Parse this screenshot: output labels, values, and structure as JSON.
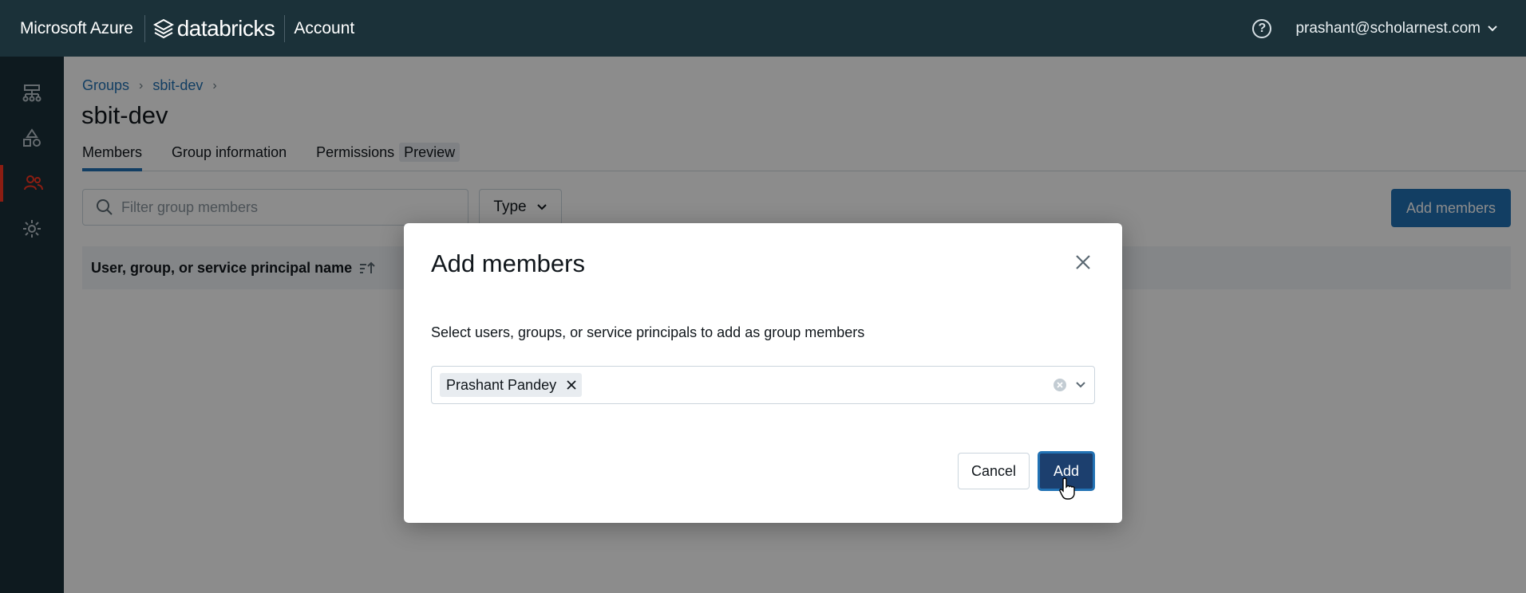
{
  "topbar": {
    "brand_azure": "Microsoft Azure",
    "brand_databricks": "databricks",
    "brand_account": "Account",
    "help_icon": "help-circle-icon",
    "user_email": "prashant@scholarnest.com"
  },
  "sidebar": {
    "items": [
      {
        "icon": "workspaces-icon"
      },
      {
        "icon": "catalog-icon"
      },
      {
        "icon": "user-management-icon",
        "active": true
      },
      {
        "icon": "settings-icon"
      }
    ],
    "active_color": "#ff3621"
  },
  "breadcrumb": {
    "items": [
      "Groups",
      "sbit-dev"
    ],
    "separator": "›"
  },
  "page": {
    "title": "sbit-dev"
  },
  "tabs": [
    {
      "label": "Members",
      "active": true
    },
    {
      "label": "Group information"
    },
    {
      "label": "Permissions",
      "badge": "Preview"
    }
  ],
  "toolbar": {
    "filter_placeholder": "Filter group members",
    "type_label": "Type",
    "add_members_label": "Add members"
  },
  "table": {
    "header": "User, group, or service principal name"
  },
  "modal": {
    "title": "Add members",
    "description": "Select users, groups, or service principals to add as group members",
    "selected": [
      "Prashant Pandey"
    ],
    "cancel_label": "Cancel",
    "add_label": "Add"
  },
  "colors": {
    "topbar_bg": "#1b3139",
    "primary": "#2272b4",
    "add_button": "#1c3f6e"
  }
}
